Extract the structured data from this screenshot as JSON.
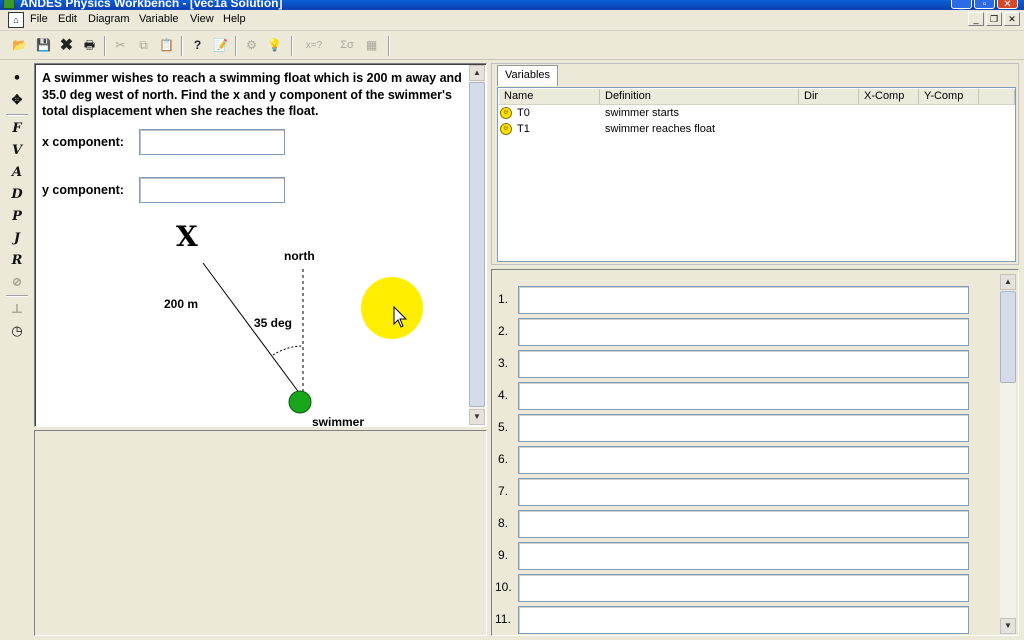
{
  "window": {
    "title": "ANDES Physics Workbench - [vec1a Solution]"
  },
  "menu": {
    "items": [
      "File",
      "Edit",
      "Diagram",
      "Variable",
      "View",
      "Help"
    ]
  },
  "problem": {
    "text": "A swimmer wishes to reach a swimming float which is 200 m away and 35.0 deg west of north.  Find the x and y component of the  swimmer's total displacement when she reaches the float.",
    "x_label": "x component:",
    "y_label": "y component:",
    "x_value": "",
    "y_value": "",
    "diagram": {
      "float_marker": "X",
      "north_label": "north",
      "distance_label": "200 m",
      "angle_label": "35 deg",
      "swimmer_label": "swimmer"
    }
  },
  "variables": {
    "tab_label": "Variables",
    "columns": [
      "Name",
      "Definition",
      "Dir",
      "X-Comp",
      "Y-Comp"
    ],
    "rows": [
      {
        "name": "T0",
        "definition": "swimmer starts",
        "dir": "",
        "x_comp": "",
        "y_comp": ""
      },
      {
        "name": "T1",
        "definition": "swimmer reaches float",
        "dir": "",
        "x_comp": "",
        "y_comp": ""
      }
    ]
  },
  "equations": {
    "numbers": [
      "1.",
      "2.",
      "3.",
      "4.",
      "5.",
      "6.",
      "7.",
      "8.",
      "9.",
      "10.",
      "11."
    ]
  },
  "toolbar": {
    "eq_tool": "x=?",
    "sum_tool": "Σσ"
  },
  "colors": {
    "titlebar": "#0a3fb0",
    "cursor_highlight": "#ffee00",
    "swimmer": "#1aa61a"
  }
}
